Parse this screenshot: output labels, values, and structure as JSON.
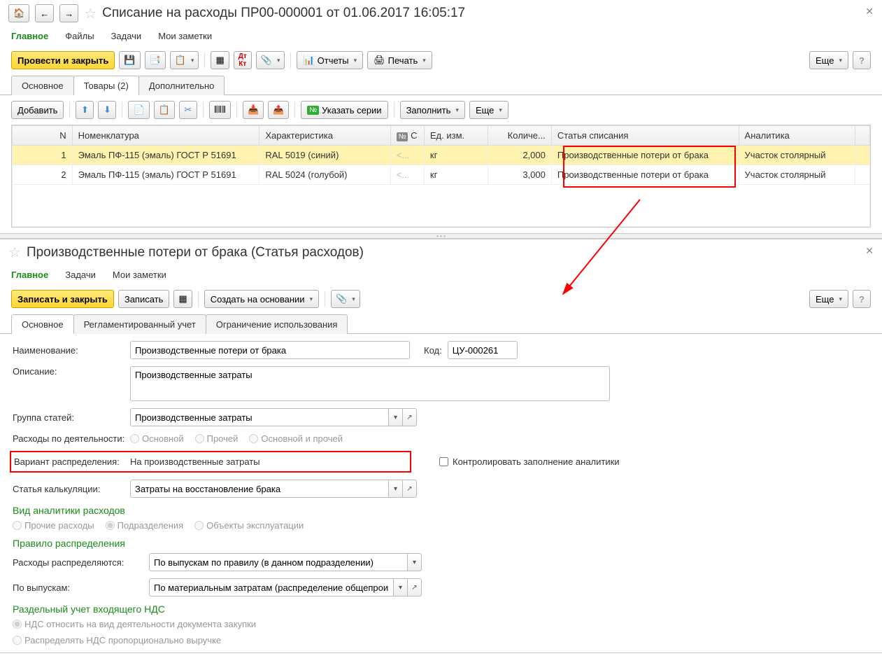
{
  "pane1": {
    "title": "Списание на расходы ПР00-000001 от 01.06.2017 16:05:17",
    "nav": [
      "Главное",
      "Файлы",
      "Задачи",
      "Мои заметки"
    ],
    "toolbar": {
      "post_close": "Провести и закрыть",
      "reports": "Отчеты",
      "print": "Печать",
      "more": "Еще"
    },
    "tabs": [
      "Основное",
      "Товары (2)",
      "Дополнительно"
    ],
    "sub": {
      "add": "Добавить",
      "series": "Указать серии",
      "fill": "Заполнить",
      "more": "Еще"
    },
    "cols": {
      "n": "N",
      "nom": "Номенклатура",
      "char": "Характеристика",
      "s": "С",
      "unit": "Ед. изм.",
      "qty": "Количе...",
      "article": "Статья списания",
      "analytics": "Аналитика"
    },
    "rows": [
      {
        "n": "1",
        "nom": "Эмаль ПФ-115 (эмаль) ГОСТ Р 51691",
        "char": "RAL 5019 (синий)",
        "s": "<...",
        "unit": "кг",
        "qty": "2,000",
        "article": "Производственные потери от брака",
        "analytics": "Участок столярный"
      },
      {
        "n": "2",
        "nom": "Эмаль ПФ-115 (эмаль) ГОСТ Р 51691",
        "char": "RAL 5024 (голубой)",
        "s": "<...",
        "unit": "кг",
        "qty": "3,000",
        "article": "Производственные потери от брака",
        "analytics": "Участок столярный"
      }
    ]
  },
  "pane2": {
    "title": "Производственные потери от брака (Статья расходов)",
    "nav": [
      "Главное",
      "Задачи",
      "Мои заметки"
    ],
    "toolbar": {
      "save_close": "Записать и закрыть",
      "save": "Записать",
      "create_based": "Создать на основании",
      "more": "Еще"
    },
    "tabs": [
      "Основное",
      "Регламентированный учет",
      "Ограничение использования"
    ],
    "fields": {
      "name_label": "Наименование:",
      "name_value": "Производственные потери от брака",
      "code_label": "Код:",
      "code_value": "ЦУ-000261",
      "desc_label": "Описание:",
      "desc_value": "Производственные затраты",
      "group_label": "Группа статей:",
      "group_value": "Производственные затраты",
      "activity_label": "Расходы по деятельности:",
      "activity_options": [
        "Основной",
        "Прочей",
        "Основной и прочей"
      ],
      "variant_label": "Вариант распределения:",
      "variant_value": "На производственные затраты",
      "control_check": "Контролировать заполнение аналитики",
      "calc_label": "Статья калькуляции:",
      "calc_value": "Затраты на восстановление брака",
      "analytics_header": "Вид аналитики расходов",
      "analytics_options": [
        "Прочие расходы",
        "Подразделения",
        "Объекты эксплуатации"
      ],
      "rule_header": "Правило распределения",
      "dist_label": "Расходы распределяются:",
      "dist_value": "По выпускам по правилу (в данном подразделении)",
      "issue_label": "По выпускам:",
      "issue_value": "По материальным затратам (распределение общепроизводс",
      "vat_header": "Раздельный учет входящего НДС",
      "vat_options": [
        "НДС относить на вид деятельности документа закупки",
        "Распределять НДС пропорционально выручке"
      ]
    }
  }
}
